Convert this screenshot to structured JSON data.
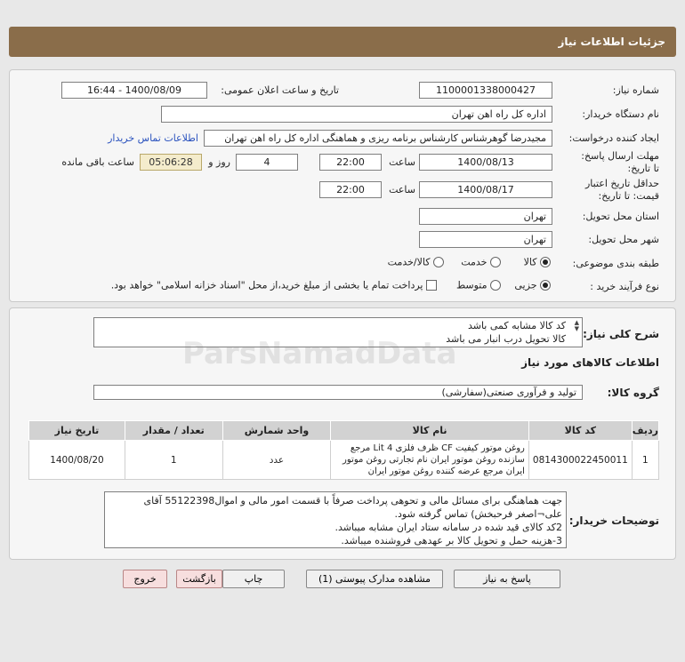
{
  "header": {
    "title": "جزئیات اطلاعات نیاز"
  },
  "form": {
    "need_number_label": "شماره نیاز:",
    "need_number": "1100001338000427",
    "announce_label": "تاریخ و ساعت اعلان عمومی:",
    "announce_value": "1400/08/09 - 16:44",
    "buyer_org_label": "نام دستگاه خریدار:",
    "buyer_org": "اداره کل راه اهن تهران",
    "creator_label": "ایجاد کننده درخواست:",
    "creator": "مجیدرضا گوهرشناس کارشناس برنامه ریزی و هماهنگی اداره کل راه اهن تهران",
    "contact_link": "اطلاعات تماس خریدار",
    "reply_deadline_label": "مهلت ارسال پاسخ: تا تاریخ:",
    "reply_date": "1400/08/13",
    "time_label": "ساعت",
    "reply_time": "22:00",
    "days": "4",
    "days_label": "روز و",
    "remaining_time": "05:06:28",
    "remaining_label": "ساعت باقی مانده",
    "price_validity_label": "حداقل تاریخ اعتبار قیمت: تا تاریخ:",
    "validity_date": "1400/08/17",
    "validity_time": "22:00",
    "delivery_province_label": "استان محل تحویل:",
    "delivery_province": "تهران",
    "delivery_city_label": "شهر محل تحویل:",
    "delivery_city": "تهران",
    "category_label": "طبقه بندی موضوعی:",
    "category_options": [
      "کالا",
      "خدمت",
      "کالا/خدمت"
    ],
    "process_label": "نوع فرآیند خرید :",
    "process_options": [
      "جزیی",
      "متوسط"
    ],
    "treasury_note": "پرداخت تمام یا بخشی از مبلغ خرید،از محل \"اسناد خزانه اسلامی\" خواهد بود."
  },
  "details": {
    "general_desc_label": "شرح کلی نیاز:",
    "general_desc_line1": "کد کالا مشابه کمی باشد",
    "general_desc_line2": "کالا تحویل درب انبار می باشد",
    "goods_info_title": "اطلاعات کالاهای مورد نیاز",
    "goods_group_label": "گروه کالا:",
    "goods_group": "تولید و فرآوری صنعتی(سفارشی)",
    "table": {
      "headers": [
        "ردیف",
        "کد کالا",
        "نام کالا",
        "واحد شمارش",
        "تعداد / مقدار",
        "تاریخ نیاز"
      ],
      "rows": [
        {
          "row": "1",
          "code": "0814300022450011",
          "name": "روغن موتور کیفیت CF ظرف فلزی 4 Lit مرجع سازنده روغن موتور ایران نام تجارتی روغن موتور ایران مرجع عرضه کننده روغن موتور ایران",
          "unit": "عدد",
          "qty": "1",
          "date": "1400/08/20"
        }
      ]
    },
    "buyer_notes_label": "توضیحات خریدار:",
    "buyer_notes": "جهت هماهنگی برای مسائل مالی و تحوهی پرداخت صرفاً با قسمت امور مالی و اموال55122398 آقای علی¬اصغر فرحبخش) تماس گرفته شود.\n2کد کالای قید شده در سامانه ستاد ایران مشابه میباشد.\n3-هزینه حمل و تحویل کالا بر عهدهی فروشنده میباشد."
  },
  "buttons": {
    "reply": "پاسخ به نیاز",
    "view_docs": "مشاهده مدارک پیوستی (1)",
    "print": "چاپ",
    "back": "بازگشت",
    "exit": "خروج"
  }
}
